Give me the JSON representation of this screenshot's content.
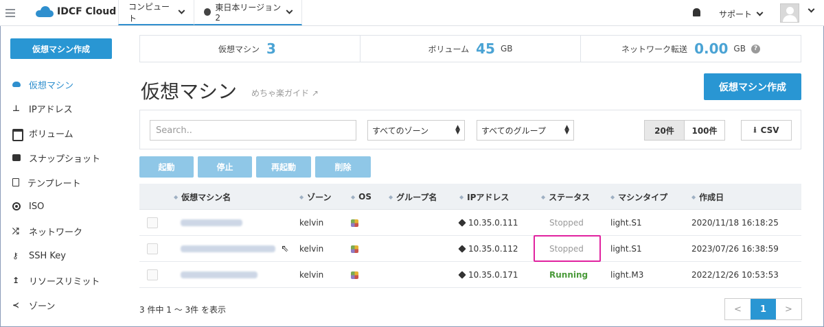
{
  "topbar": {
    "logo": "IDCF Cloud",
    "nav_compute": "コンピュート",
    "nav_region": "東日本リージョン2",
    "support": "サポート"
  },
  "sidebar": {
    "create_button": "仮想マシン作成",
    "items": [
      {
        "label": "仮想マシン",
        "icon": "cloud-icon",
        "active": true
      },
      {
        "label": "IPアドレス",
        "icon": "network-icon"
      },
      {
        "label": "ボリューム",
        "icon": "hdd-icon"
      },
      {
        "label": "スナップショット",
        "icon": "camera-icon"
      },
      {
        "label": "テンプレート",
        "icon": "document-icon"
      },
      {
        "label": "ISO",
        "icon": "disc-icon"
      },
      {
        "label": "ネットワーク",
        "icon": "shuffle-icon"
      },
      {
        "label": "SSH Key",
        "icon": "key-icon"
      },
      {
        "label": "リソースリミット",
        "icon": "arrow-up-icon"
      },
      {
        "label": "ゾーン",
        "icon": "share-icon"
      }
    ]
  },
  "stats": {
    "vm_label": "仮想マシン",
    "vm_count": "3",
    "volume_label": "ボリューム",
    "volume_value": "45",
    "volume_unit": "GB",
    "transfer_label": "ネットワーク転送",
    "transfer_value": "0.00",
    "transfer_unit": "GB"
  },
  "main": {
    "title": "仮想マシン",
    "guide_link": "めちゃ楽ガイド",
    "create_button": "仮想マシン作成"
  },
  "filters": {
    "search_placeholder": "Search..",
    "zone_select": "すべてのゾーン",
    "group_select": "すべてのグループ",
    "page_size_20": "20件",
    "page_size_100": "100件",
    "csv": "CSV"
  },
  "actions": {
    "start": "起動",
    "stop": "停止",
    "restart": "再起動",
    "delete": "削除"
  },
  "table": {
    "headers": [
      "仮想マシン名",
      "ゾーン",
      "OS",
      "グループ名",
      "IPアドレス",
      "ステータス",
      "マシンタイプ",
      "作成日"
    ],
    "rows": [
      {
        "zone": "kelvin",
        "ip": "10.35.0.111",
        "status": "Stopped",
        "type": "light.S1",
        "created": "2020/11/18 16:18:25"
      },
      {
        "zone": "kelvin",
        "ip": "10.35.0.112",
        "status": "Stopped",
        "type": "light.S1",
        "created": "2023/07/26 16:38:59"
      },
      {
        "zone": "kelvin",
        "ip": "10.35.0.171",
        "status": "Running",
        "type": "light.M3",
        "created": "2022/12/26 10:53:53"
      }
    ]
  },
  "footer": {
    "count_text": "3 件中 1 ～ 3件 を表示",
    "prev": "<",
    "current_page": "1",
    "next": ">"
  },
  "colors": {
    "accent": "#2996d3",
    "action_disabled": "#8fc7e7",
    "running": "#4a9a3a",
    "highlight_box": "#e0219f"
  }
}
